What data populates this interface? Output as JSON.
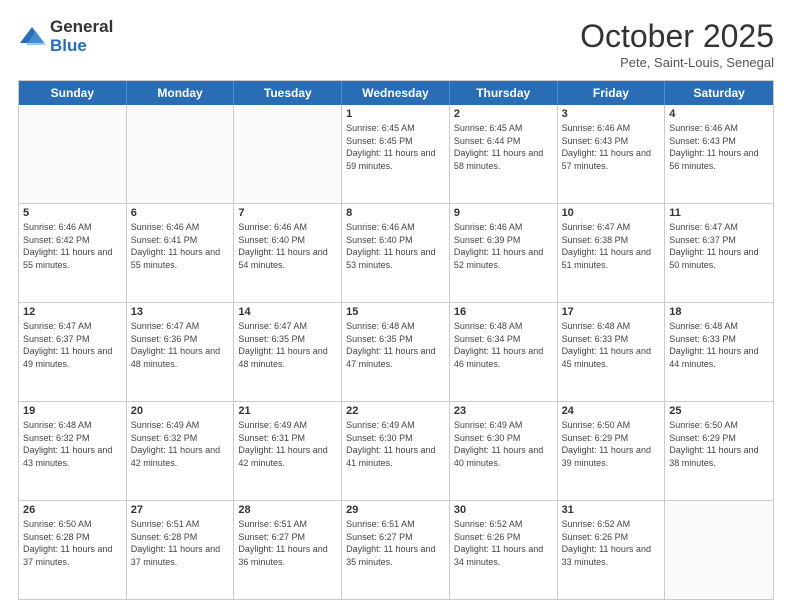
{
  "logo": {
    "general": "General",
    "blue": "Blue"
  },
  "header": {
    "month": "October 2025",
    "location": "Pete, Saint-Louis, Senegal"
  },
  "weekdays": [
    "Sunday",
    "Monday",
    "Tuesday",
    "Wednesday",
    "Thursday",
    "Friday",
    "Saturday"
  ],
  "weeks": [
    [
      {
        "day": "",
        "sunrise": "",
        "sunset": "",
        "daylight": ""
      },
      {
        "day": "",
        "sunrise": "",
        "sunset": "",
        "daylight": ""
      },
      {
        "day": "",
        "sunrise": "",
        "sunset": "",
        "daylight": ""
      },
      {
        "day": "1",
        "sunrise": "Sunrise: 6:45 AM",
        "sunset": "Sunset: 6:45 PM",
        "daylight": "Daylight: 11 hours and 59 minutes."
      },
      {
        "day": "2",
        "sunrise": "Sunrise: 6:45 AM",
        "sunset": "Sunset: 6:44 PM",
        "daylight": "Daylight: 11 hours and 58 minutes."
      },
      {
        "day": "3",
        "sunrise": "Sunrise: 6:46 AM",
        "sunset": "Sunset: 6:43 PM",
        "daylight": "Daylight: 11 hours and 57 minutes."
      },
      {
        "day": "4",
        "sunrise": "Sunrise: 6:46 AM",
        "sunset": "Sunset: 6:43 PM",
        "daylight": "Daylight: 11 hours and 56 minutes."
      }
    ],
    [
      {
        "day": "5",
        "sunrise": "Sunrise: 6:46 AM",
        "sunset": "Sunset: 6:42 PM",
        "daylight": "Daylight: 11 hours and 55 minutes."
      },
      {
        "day": "6",
        "sunrise": "Sunrise: 6:46 AM",
        "sunset": "Sunset: 6:41 PM",
        "daylight": "Daylight: 11 hours and 55 minutes."
      },
      {
        "day": "7",
        "sunrise": "Sunrise: 6:46 AM",
        "sunset": "Sunset: 6:40 PM",
        "daylight": "Daylight: 11 hours and 54 minutes."
      },
      {
        "day": "8",
        "sunrise": "Sunrise: 6:46 AM",
        "sunset": "Sunset: 6:40 PM",
        "daylight": "Daylight: 11 hours and 53 minutes."
      },
      {
        "day": "9",
        "sunrise": "Sunrise: 6:46 AM",
        "sunset": "Sunset: 6:39 PM",
        "daylight": "Daylight: 11 hours and 52 minutes."
      },
      {
        "day": "10",
        "sunrise": "Sunrise: 6:47 AM",
        "sunset": "Sunset: 6:38 PM",
        "daylight": "Daylight: 11 hours and 51 minutes."
      },
      {
        "day": "11",
        "sunrise": "Sunrise: 6:47 AM",
        "sunset": "Sunset: 6:37 PM",
        "daylight": "Daylight: 11 hours and 50 minutes."
      }
    ],
    [
      {
        "day": "12",
        "sunrise": "Sunrise: 6:47 AM",
        "sunset": "Sunset: 6:37 PM",
        "daylight": "Daylight: 11 hours and 49 minutes."
      },
      {
        "day": "13",
        "sunrise": "Sunrise: 6:47 AM",
        "sunset": "Sunset: 6:36 PM",
        "daylight": "Daylight: 11 hours and 48 minutes."
      },
      {
        "day": "14",
        "sunrise": "Sunrise: 6:47 AM",
        "sunset": "Sunset: 6:35 PM",
        "daylight": "Daylight: 11 hours and 48 minutes."
      },
      {
        "day": "15",
        "sunrise": "Sunrise: 6:48 AM",
        "sunset": "Sunset: 6:35 PM",
        "daylight": "Daylight: 11 hours and 47 minutes."
      },
      {
        "day": "16",
        "sunrise": "Sunrise: 6:48 AM",
        "sunset": "Sunset: 6:34 PM",
        "daylight": "Daylight: 11 hours and 46 minutes."
      },
      {
        "day": "17",
        "sunrise": "Sunrise: 6:48 AM",
        "sunset": "Sunset: 6:33 PM",
        "daylight": "Daylight: 11 hours and 45 minutes."
      },
      {
        "day": "18",
        "sunrise": "Sunrise: 6:48 AM",
        "sunset": "Sunset: 6:33 PM",
        "daylight": "Daylight: 11 hours and 44 minutes."
      }
    ],
    [
      {
        "day": "19",
        "sunrise": "Sunrise: 6:48 AM",
        "sunset": "Sunset: 6:32 PM",
        "daylight": "Daylight: 11 hours and 43 minutes."
      },
      {
        "day": "20",
        "sunrise": "Sunrise: 6:49 AM",
        "sunset": "Sunset: 6:32 PM",
        "daylight": "Daylight: 11 hours and 42 minutes."
      },
      {
        "day": "21",
        "sunrise": "Sunrise: 6:49 AM",
        "sunset": "Sunset: 6:31 PM",
        "daylight": "Daylight: 11 hours and 42 minutes."
      },
      {
        "day": "22",
        "sunrise": "Sunrise: 6:49 AM",
        "sunset": "Sunset: 6:30 PM",
        "daylight": "Daylight: 11 hours and 41 minutes."
      },
      {
        "day": "23",
        "sunrise": "Sunrise: 6:49 AM",
        "sunset": "Sunset: 6:30 PM",
        "daylight": "Daylight: 11 hours and 40 minutes."
      },
      {
        "day": "24",
        "sunrise": "Sunrise: 6:50 AM",
        "sunset": "Sunset: 6:29 PM",
        "daylight": "Daylight: 11 hours and 39 minutes."
      },
      {
        "day": "25",
        "sunrise": "Sunrise: 6:50 AM",
        "sunset": "Sunset: 6:29 PM",
        "daylight": "Daylight: 11 hours and 38 minutes."
      }
    ],
    [
      {
        "day": "26",
        "sunrise": "Sunrise: 6:50 AM",
        "sunset": "Sunset: 6:28 PM",
        "daylight": "Daylight: 11 hours and 37 minutes."
      },
      {
        "day": "27",
        "sunrise": "Sunrise: 6:51 AM",
        "sunset": "Sunset: 6:28 PM",
        "daylight": "Daylight: 11 hours and 37 minutes."
      },
      {
        "day": "28",
        "sunrise": "Sunrise: 6:51 AM",
        "sunset": "Sunset: 6:27 PM",
        "daylight": "Daylight: 11 hours and 36 minutes."
      },
      {
        "day": "29",
        "sunrise": "Sunrise: 6:51 AM",
        "sunset": "Sunset: 6:27 PM",
        "daylight": "Daylight: 11 hours and 35 minutes."
      },
      {
        "day": "30",
        "sunrise": "Sunrise: 6:52 AM",
        "sunset": "Sunset: 6:26 PM",
        "daylight": "Daylight: 11 hours and 34 minutes."
      },
      {
        "day": "31",
        "sunrise": "Sunrise: 6:52 AM",
        "sunset": "Sunset: 6:26 PM",
        "daylight": "Daylight: 11 hours and 33 minutes."
      },
      {
        "day": "",
        "sunrise": "",
        "sunset": "",
        "daylight": ""
      }
    ]
  ]
}
